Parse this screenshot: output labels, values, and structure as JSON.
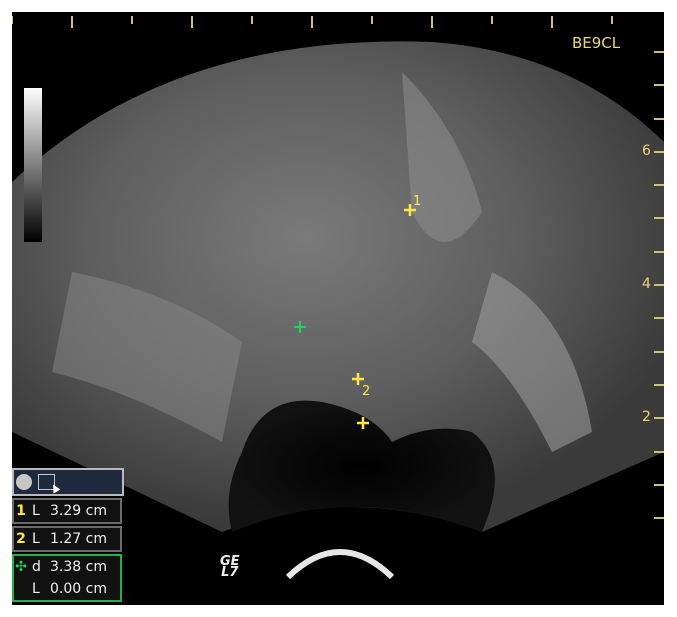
{
  "probe_label": "BE9CL",
  "depth_labels": [
    "6",
    "4",
    "2"
  ],
  "ge_logo": {
    "line1": "GE",
    "line2": "L7"
  },
  "caliper_labels": [
    "1",
    "2"
  ],
  "measurements": [
    {
      "number": "1",
      "type": "L",
      "value": "3.29 cm"
    },
    {
      "number": "2",
      "type": "L",
      "value": "1.27 cm"
    },
    {
      "number": "",
      "type": "d",
      "value": "3.38 cm"
    },
    {
      "number": "",
      "type": "L",
      "value": "0.00 cm"
    }
  ],
  "colors": {
    "overlay": "#e8d87a",
    "caliper": "#ffe54a",
    "active_caliper": "#1fd35a"
  }
}
